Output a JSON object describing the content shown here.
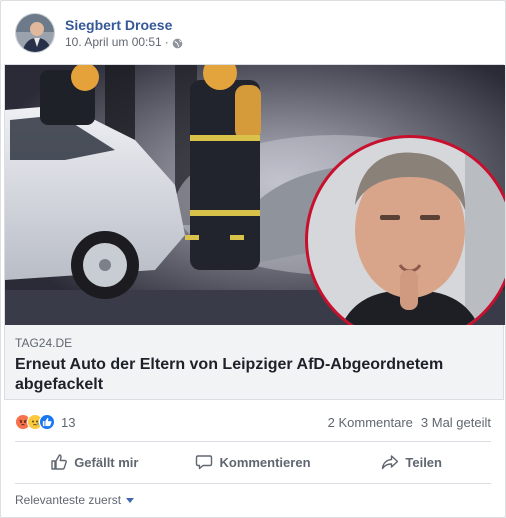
{
  "post": {
    "author": "Siegbert Droese",
    "timestamp": "10. April um 00:51",
    "separator": "·",
    "privacy_icon": "globe-icon"
  },
  "link": {
    "domain": "TAG24.DE",
    "headline": "Erneut Auto der Eltern von Leipziger AfD-Abgeordnetem abgefackelt"
  },
  "stats": {
    "reactions": [
      "angry",
      "sad",
      "like"
    ],
    "reaction_count": "13",
    "comments": "2 Kommentare",
    "shares": "3 Mal geteilt"
  },
  "actions": {
    "like": "Gefällt mir",
    "comment": "Kommentieren",
    "share": "Teilen"
  },
  "comments": {
    "sort_label": "Relevanteste zuerst"
  },
  "colors": {
    "author_link": "#365899",
    "secondary_text": "#606770",
    "like_blue": "#1877f2",
    "angry_orange": "#f7714c",
    "sad_yellow": "#fcc93d"
  }
}
